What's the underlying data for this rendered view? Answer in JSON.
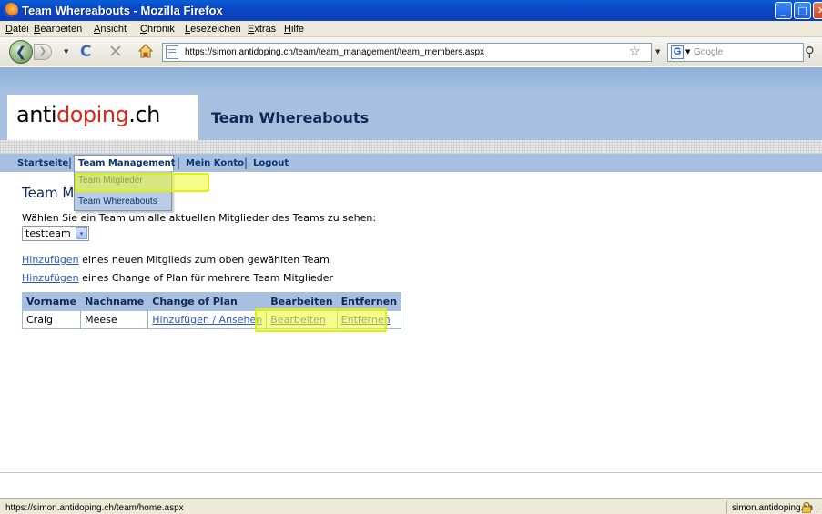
{
  "window": {
    "title": "Team Whereabouts - Mozilla Firefox",
    "min_glyph": "_",
    "max_glyph": "□",
    "close_glyph": "✕"
  },
  "menubar": [
    "Datei",
    "Bearbeiten",
    "Ansicht",
    "Chronik",
    "Lesezeichen",
    "Extras",
    "Hilfe"
  ],
  "toolbar": {
    "back_glyph": "❮",
    "forward_glyph": "❯",
    "reload_glyph": "C",
    "stop_glyph": "✕",
    "dropdown_glyph": "▼",
    "url": "https://simon.antidoping.ch/team/team_management/team_members.aspx",
    "bookmark_glyph": "☆",
    "search_engine_glyph": "G",
    "search_placeholder": "Google",
    "search_go_glyph": "⚲"
  },
  "site": {
    "logo_part1": "anti",
    "logo_part2": "doping",
    "logo_part3": ".ch",
    "title": "Team Whereabouts"
  },
  "nav": {
    "items": [
      "Startseite",
      "Team Management",
      "Mein Konto",
      "Logout"
    ],
    "separator": "|",
    "active": "Team Management",
    "dropdown": [
      "Team Mitglieder",
      "Team Whereabouts"
    ]
  },
  "content": {
    "heading": "Team M",
    "select_prompt": "Wählen Sie ein Team um alle aktuellen Mitglieder des Teams zu sehen:",
    "team_select": {
      "value": "testteam",
      "arrow": "▾"
    },
    "add_member_link": "Hinzufügen",
    "add_member_text": " eines neuen Mitglieds zum oben gewählten Team",
    "add_plan_link": "Hinzufügen",
    "add_plan_text": " eines Change of Plan für mehrere Team Mitglieder",
    "table": {
      "headers": [
        "Vorname",
        "Nachname",
        "Change of Plan",
        "Bearbeiten",
        "Entfernen"
      ],
      "rows": [
        {
          "vorname": "Craig",
          "nachname": "Meese",
          "plan": "Hinzufügen / Ansehen",
          "edit": "Bearbeiten",
          "remove": "Entfernen"
        }
      ]
    }
  },
  "statusbar": {
    "url": "https://simon.antidoping.ch/team/home.aspx",
    "host": "simon.antidoping.ch",
    "grip": "⋰"
  },
  "colors": {
    "titlebar": "#0a46c8",
    "header_blue": "#a7c0e0",
    "nav_text": "#0b3572",
    "link": "#2a57c8",
    "logo_red": "#d9271c",
    "highlight": "#f0fc28"
  }
}
